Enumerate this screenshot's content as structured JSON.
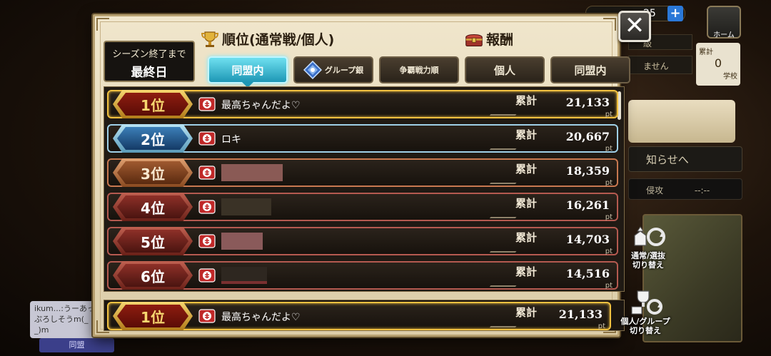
{
  "background": {
    "top_counter": "25",
    "home_label": "ホーム",
    "notice": "知らせへ",
    "attack": "侵攻",
    "attack_value": "--:--",
    "info_bar_1": "級",
    "info_bar_2": "ません",
    "rank_card_label": "累計",
    "rank_card_value": "0",
    "rank_card_sub": "学校",
    "chat_text": "ikum...:うーあっぷろしそうm(_ _)m",
    "chat_tab": "同盟"
  },
  "dialog": {
    "close_label": "✕",
    "season": {
      "label": "シーズン終了まで",
      "value": "最終日"
    },
    "ranking_title": "順位(通常戦/個人)",
    "reward_title": "報酬",
    "tabs": [
      {
        "label": "同盟内",
        "active": true
      },
      {
        "label": "グループ銀",
        "active": false
      },
      {
        "label": "争覇戦力順",
        "active": false
      },
      {
        "label": "個人",
        "active": false
      },
      {
        "label": "同盟内",
        "active": false
      }
    ],
    "total_label": "累計",
    "pt_unit": "pt",
    "rows": [
      {
        "rank": "1位",
        "name": "最高ちゃんだよ♡",
        "score": "21,133",
        "style": "gold"
      },
      {
        "rank": "2位",
        "name": "ロキ",
        "score": "20,667",
        "style": "silver"
      },
      {
        "rank": "3位",
        "name": "",
        "score": "18,359",
        "style": "bronze"
      },
      {
        "rank": "4位",
        "name": "",
        "score": "16,261",
        "style": "red"
      },
      {
        "rank": "5位",
        "name": "",
        "score": "14,703",
        "style": "red"
      },
      {
        "rank": "6位",
        "name": "",
        "score": "14,516",
        "style": "red"
      }
    ],
    "my_rank": {
      "rank": "1位",
      "name": "最高ちゃんだよ♡",
      "score": "21,133"
    }
  },
  "side_buttons": {
    "mode_switch": "通常/選抜\n切り替え",
    "group_switch": "個人/グループ\n切り替え"
  }
}
